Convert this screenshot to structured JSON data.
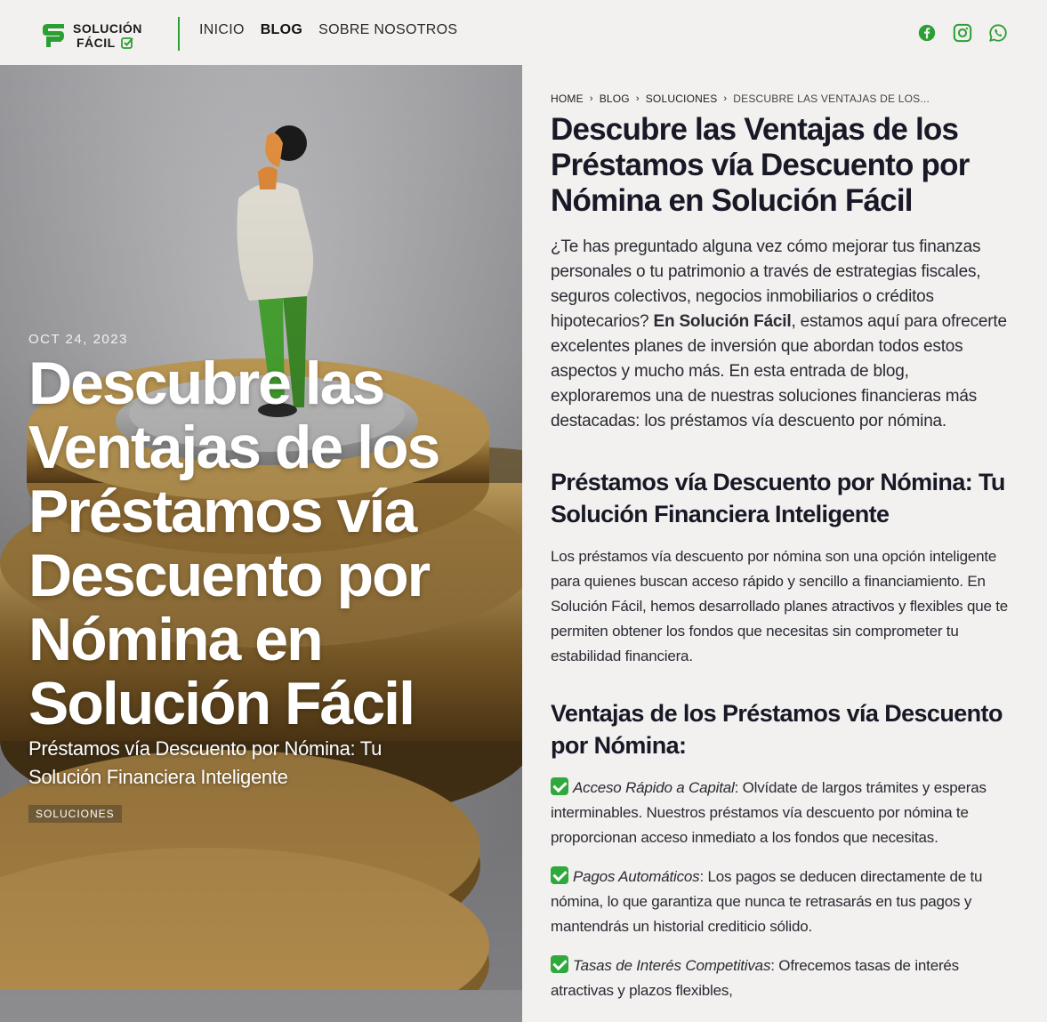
{
  "header": {
    "logo_line1": "SOLUCIÓN",
    "logo_line2": "FÁCIL",
    "nav": [
      {
        "label": "INICIO"
      },
      {
        "label": "BLOG"
      },
      {
        "label": "SOBRE NOSOTROS"
      }
    ],
    "social": [
      "facebook-icon",
      "instagram-icon",
      "whatsapp-icon"
    ]
  },
  "hero": {
    "date": "OCT 24, 2023",
    "title": "Descubre las Ventajas de los Préstamos vía Descuento por Nómina en Solución Fácil",
    "subtitle": "Préstamos vía Descuento por Nómina: Tu Solución Financiera Inteligente",
    "tag": "SOLUCIONES"
  },
  "breadcrumb": {
    "items": [
      "HOME",
      "BLOG",
      "SOLUCIONES",
      "DESCUBRE LAS VENTAJAS DE LOS..."
    ]
  },
  "article": {
    "title": "Descubre las Ventajas de los Préstamos vía Descuento por Nómina en Solución Fácil",
    "intro_pre": "¿Te has preguntado alguna vez cómo mejorar tus finanzas personales o tu patrimonio a través de estrategias fiscales, seguros colectivos, negocios inmobiliarios o créditos hipotecarios? ",
    "intro_bold": "En Solución Fácil",
    "intro_post": ", estamos aquí para ofrecerte excelentes planes de inversión que abordan todos estos aspectos y mucho más. En esta entrada de blog, exploraremos una de nuestras soluciones financieras más destacadas: los préstamos vía descuento por nómina.",
    "h2_1": "Préstamos vía Descuento por Nómina: Tu Solución Financiera Inteligente",
    "p1": "Los préstamos vía descuento por nómina son una opción inteligente para quienes buscan acceso rápido y sencillo a financiamiento. En Solución Fácil, hemos desarrollado planes atractivos y flexibles que te permiten obtener los fondos que necesitas sin comprometer tu estabilidad financiera.",
    "h2_2": "Ventajas de los Préstamos vía Descuento por Nómina:",
    "benefits": [
      {
        "title": "Acceso Rápido a Capital",
        "text": ": Olvídate de largos trámites y esperas interminables. Nuestros préstamos vía descuento por nómina te proporcionan acceso inmediato a los fondos que necesitas."
      },
      {
        "title": "Pagos Automáticos",
        "text": ": Los pagos se deducen directamente de tu nómina, lo que garantiza que nunca te retrasarás en tus pagos y mantendrás un historial crediticio sólido."
      },
      {
        "title": "Tasas de Interés Competitivas",
        "text": ": Ofrecemos tasas de interés atractivas y plazos flexibles,"
      }
    ]
  },
  "colors": {
    "brand_green": "#2c9f34",
    "page_bg": "#f2f1ef"
  }
}
